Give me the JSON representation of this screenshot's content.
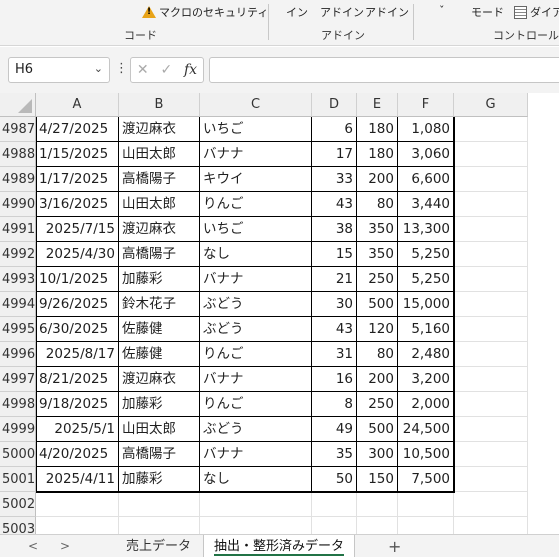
{
  "ribbon": {
    "macro_security": "マクロのセキュリティ",
    "group_code": "コード",
    "addin_1": "イン",
    "addin_2": "アドイン",
    "addin_3": "アドイン",
    "group_addin": "アドイン",
    "chevron": "ˇ",
    "mode": "モード",
    "dialog": "ダイア",
    "group_control": "コントロール"
  },
  "formula_bar": {
    "name_box": "H6",
    "name_box_arrow": "⌄",
    "dots": "⋮",
    "cancel": "✕",
    "confirm": "✓",
    "fx": "fx",
    "formula": ""
  },
  "columns": [
    "A",
    "B",
    "C",
    "D",
    "E",
    "F",
    "G"
  ],
  "rows": [
    {
      "n": "4987",
      "a": "4/27/2025",
      "b": "渡辺麻衣",
      "c": "いちご",
      "d": "6",
      "e": "180",
      "f": "1,080"
    },
    {
      "n": "4988",
      "a": "1/15/2025",
      "b": "山田太郎",
      "c": "バナナ",
      "d": "17",
      "e": "180",
      "f": "3,060"
    },
    {
      "n": "4989",
      "a": "1/17/2025",
      "b": "高橋陽子",
      "c": "キウイ",
      "d": "33",
      "e": "200",
      "f": "6,600"
    },
    {
      "n": "4990",
      "a": "3/16/2025",
      "b": "山田太郎",
      "c": "りんご",
      "d": "43",
      "e": "80",
      "f": "3,440"
    },
    {
      "n": "4991",
      "a": "2025/7/15",
      "b": "渡辺麻衣",
      "c": "いちご",
      "d": "38",
      "e": "350",
      "f": "13,300"
    },
    {
      "n": "4992",
      "a": "2025/4/30",
      "b": "高橋陽子",
      "c": "なし",
      "d": "15",
      "e": "350",
      "f": "5,250"
    },
    {
      "n": "4993",
      "a": "10/1/2025",
      "b": "加藤彩",
      "c": "バナナ",
      "d": "21",
      "e": "250",
      "f": "5,250"
    },
    {
      "n": "4994",
      "a": "9/26/2025",
      "b": "鈴木花子",
      "c": "ぶどう",
      "d": "30",
      "e": "500",
      "f": "15,000"
    },
    {
      "n": "4995",
      "a": "6/30/2025",
      "b": " 佐藤健",
      "c": "ぶどう",
      "d": "43",
      "e": "120",
      "f": "5,160"
    },
    {
      "n": "4996",
      "a": "2025/8/17",
      "b": "佐藤健",
      "c": "りんご",
      "d": "31",
      "e": "80",
      "f": "2,480"
    },
    {
      "n": "4997",
      "a": "8/21/2025",
      "b": "渡辺麻衣",
      "c": "バナナ",
      "d": "16",
      "e": "200",
      "f": "3,200"
    },
    {
      "n": "4998",
      "a": "9/18/2025",
      "b": "加藤彩",
      "c": "りんご",
      "d": "8",
      "e": "250",
      "f": "2,000"
    },
    {
      "n": "4999",
      "a": "2025/5/1",
      "b": "山田太郎",
      "c": "ぶどう",
      "d": "49",
      "e": "500",
      "f": "24,500"
    },
    {
      "n": "5000",
      "a": "4/20/2025",
      "b": "高橋陽子",
      "c": "バナナ",
      "d": "35",
      "e": "300",
      "f": "10,500"
    },
    {
      "n": "5001",
      "a": "2025/4/11",
      "b": "加藤彩",
      "c": "なし",
      "d": "50",
      "e": "150",
      "f": "7,500"
    },
    {
      "n": "5002",
      "a": "",
      "b": "",
      "c": "",
      "d": "",
      "e": "",
      "f": ""
    },
    {
      "n": "5003",
      "a": "",
      "b": "",
      "c": "",
      "d": "",
      "e": "",
      "f": ""
    }
  ],
  "a_align": [
    "l",
    "l",
    "l",
    "l",
    "r",
    "r",
    "l",
    "l",
    "l",
    "r",
    "l",
    "l",
    "r",
    "l",
    "r",
    "l",
    "l"
  ],
  "tabs": {
    "prev": "<",
    "next": ">",
    "sheet1": "売上データ",
    "sheet2": "抽出・整形済みデータ",
    "add": "+"
  },
  "colors": {
    "accent": "#217346"
  }
}
